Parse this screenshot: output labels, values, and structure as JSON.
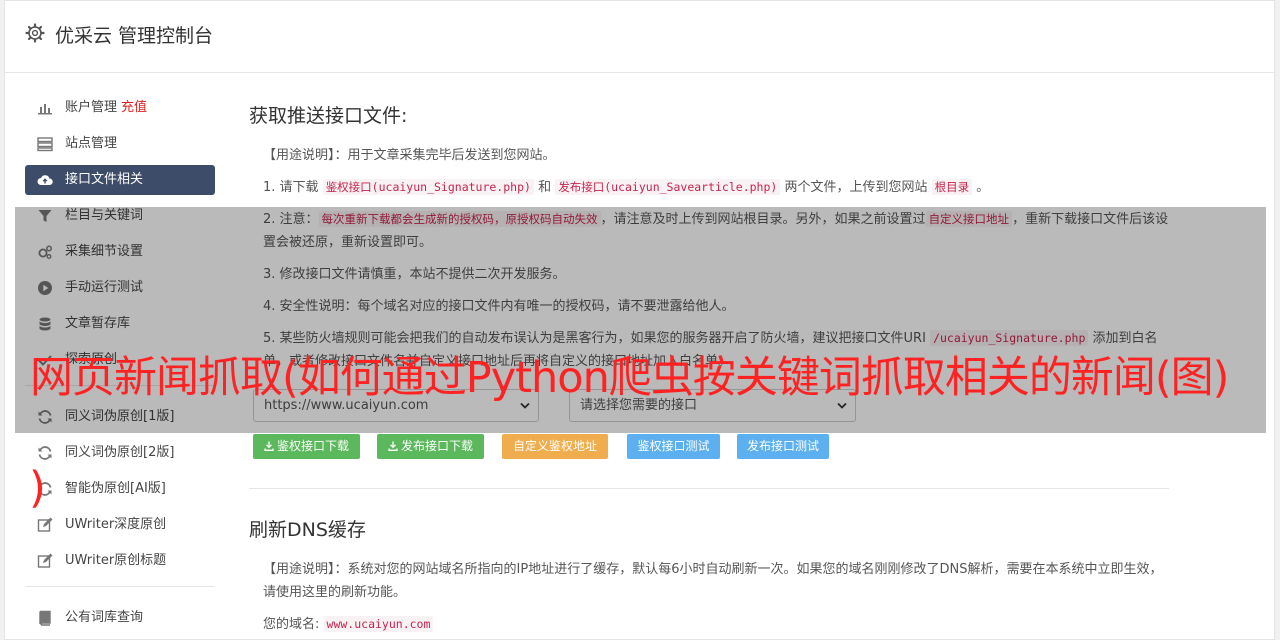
{
  "header": {
    "title": "优采云 管理控制台"
  },
  "sidebar": {
    "account": "账户管理",
    "recharge": "充值",
    "items_top": [
      {
        "label": "站点管理",
        "icon": "server-icon"
      },
      {
        "label": "接口文件相关",
        "icon": "cloud-upload-icon",
        "active": true
      },
      {
        "label": "栏目与关键词",
        "icon": "filter-icon"
      },
      {
        "label": "采集细节设置",
        "icon": "gears-icon"
      },
      {
        "label": "手动运行测试",
        "icon": "play-circle-icon"
      },
      {
        "label": "文章暂存库",
        "icon": "database-icon"
      },
      {
        "label": "探索原创",
        "icon": "check-icon"
      }
    ],
    "items_bottom": [
      {
        "label": "同义词伪原创[1版]",
        "icon": "refresh-icon"
      },
      {
        "label": "同义词伪原创[2版]",
        "icon": "refresh-icon"
      },
      {
        "label": "智能伪原创[AI版]",
        "icon": "refresh-icon"
      },
      {
        "label": "UWriter深度原创",
        "icon": "edit-icon"
      },
      {
        "label": "UWriter原创标题",
        "icon": "edit-icon"
      }
    ],
    "items_extra": [
      {
        "label": "公有词库查询",
        "icon": "book-icon"
      }
    ]
  },
  "section1": {
    "title": "获取推送接口文件:",
    "usage_label": "【用途说明】",
    "usage_text": "：用于文章采集完毕后发送到您网站。",
    "step1_a": "1. 请下载",
    "step1_code1": "鉴权接口(ucaiyun_Signature.php)",
    "step1_b": "和",
    "step1_code2": "发布接口(ucaiyun_Savearticle.php)",
    "step1_c": "两个文件，上传到您网站",
    "step1_code3": "根目录",
    "step1_d": "。",
    "step2_a": "2. 注意：",
    "step2_code1": "每次重新下载都会生成新的授权码，原授权码自动失效",
    "step2_b": "，请注意及时上传到网站根目录。另外，如果之前设置过",
    "step2_code2": "自定义接口地址",
    "step2_c": "，重新下载接口文件后该设置会被还原，重新设置即可。",
    "step3": "3. 修改接口文件请慎重，本站不提供二次开发服务。",
    "step4": "4. 安全性说明：每个域名对应的接口文件内有唯一的授权码，请不要泄露给他人。",
    "step5_a": "5. 某些防火墙规则可能会把我们的自动发布误认为是黑客行为，如果您的服务器开启了防火墙，建议把接口文件URI",
    "step5_code": "/ucaiyun_Signature.php",
    "step5_b": "添加到白名单，或者修改接口文件名并自定义接口地址后再将自定义的接口地址加入白名单。",
    "select_site": "https://www.ucaiyun.com",
    "select_api": "请选择您需要的接口",
    "btn_sign_download": "鉴权接口下载",
    "btn_publish_download": "发布接口下载",
    "btn_custom": "自定义鉴权地址",
    "btn_sign_test": "鉴权接口测试",
    "btn_publish_test": "发布接口测试"
  },
  "section2": {
    "title": "刷新DNS缓存",
    "usage_label": "【用途说明】",
    "usage_text": "：系统对您的网站域名所指向的IP地址进行了缓存，默认每6小时自动刷新一次。如果您的域名刚刚修改了DNS解析，需要在本系统中立即生效，请使用这里的刷新功能。",
    "domain_label": "您的域名:",
    "domain_value": "www.ucaiyun.com"
  },
  "overlay": {
    "banner": "网页新闻抓取(如何通过Python爬虫按关键词抓取相关的新闻(图)",
    "banner_end": ")"
  }
}
